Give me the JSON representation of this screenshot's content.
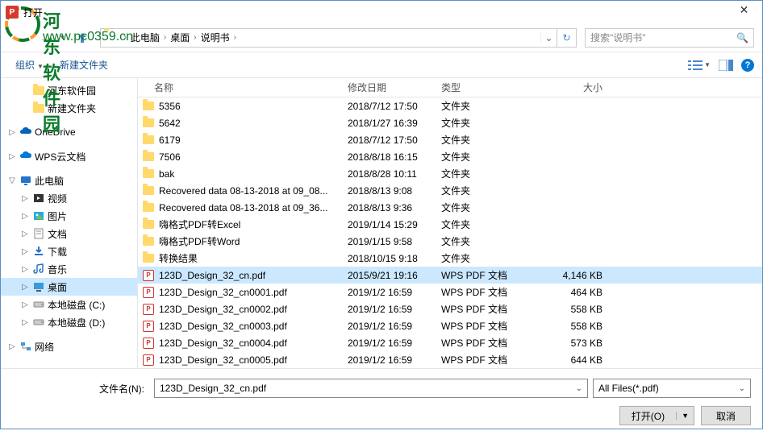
{
  "title": "打开",
  "watermark": {
    "text1": "河东软件园",
    "text2": "www.pc0359.cn"
  },
  "nav": {
    "crumbs": [
      "此电脑",
      "桌面",
      "说明书"
    ],
    "search_placeholder": "搜索\"说明书\""
  },
  "toolbar": {
    "organize": "组织",
    "new_folder": "新建文件夹"
  },
  "tree": [
    {
      "exp": "",
      "icon": "folder",
      "label": "河东软件园",
      "indent": 1
    },
    {
      "exp": "",
      "icon": "folder",
      "label": "新建文件夹",
      "indent": 1
    },
    {
      "spacer": true
    },
    {
      "exp": "▷",
      "icon": "onedrive",
      "label": "OneDrive",
      "indent": 0
    },
    {
      "spacer": true
    },
    {
      "exp": "▷",
      "icon": "wps",
      "label": "WPS云文档",
      "indent": 0
    },
    {
      "spacer": true
    },
    {
      "exp": "▽",
      "icon": "pc",
      "label": "此电脑",
      "indent": 0
    },
    {
      "exp": "▷",
      "icon": "video",
      "label": "视频",
      "indent": 1
    },
    {
      "exp": "▷",
      "icon": "pic",
      "label": "图片",
      "indent": 1
    },
    {
      "exp": "▷",
      "icon": "doc",
      "label": "文档",
      "indent": 1
    },
    {
      "exp": "▷",
      "icon": "dl",
      "label": "下载",
      "indent": 1
    },
    {
      "exp": "▷",
      "icon": "music",
      "label": "音乐",
      "indent": 1
    },
    {
      "exp": "▷",
      "icon": "desktop",
      "label": "桌面",
      "indent": 1,
      "sel": true
    },
    {
      "exp": "▷",
      "icon": "disk",
      "label": "本地磁盘 (C:)",
      "indent": 1
    },
    {
      "exp": "▷",
      "icon": "disk",
      "label": "本地磁盘 (D:)",
      "indent": 1
    },
    {
      "spacer": true
    },
    {
      "exp": "▷",
      "icon": "net",
      "label": "网络",
      "indent": 0
    }
  ],
  "columns": {
    "name": "名称",
    "date": "修改日期",
    "type": "类型",
    "size": "大小"
  },
  "rows": [
    {
      "icon": "folder",
      "name": "5356",
      "date": "2018/7/12 17:50",
      "type": "文件夹",
      "size": ""
    },
    {
      "icon": "folder",
      "name": "5642",
      "date": "2018/1/27 16:39",
      "type": "文件夹",
      "size": ""
    },
    {
      "icon": "folder",
      "name": "6179",
      "date": "2018/7/12 17:50",
      "type": "文件夹",
      "size": ""
    },
    {
      "icon": "folder",
      "name": "7506",
      "date": "2018/8/18 16:15",
      "type": "文件夹",
      "size": ""
    },
    {
      "icon": "folder",
      "name": "bak",
      "date": "2018/8/28 10:11",
      "type": "文件夹",
      "size": ""
    },
    {
      "icon": "folder",
      "name": "Recovered data 08-13-2018 at 09_08...",
      "date": "2018/8/13 9:08",
      "type": "文件夹",
      "size": ""
    },
    {
      "icon": "folder",
      "name": "Recovered data 08-13-2018 at 09_36...",
      "date": "2018/8/13 9:36",
      "type": "文件夹",
      "size": ""
    },
    {
      "icon": "folder",
      "name": "嗨格式PDF转Excel",
      "date": "2019/1/14 15:29",
      "type": "文件夹",
      "size": ""
    },
    {
      "icon": "folder",
      "name": "嗨格式PDF转Word",
      "date": "2019/1/15 9:58",
      "type": "文件夹",
      "size": ""
    },
    {
      "icon": "folder",
      "name": "转换结果",
      "date": "2018/10/15 9:18",
      "type": "文件夹",
      "size": ""
    },
    {
      "icon": "pdf",
      "name": "123D_Design_32_cn.pdf",
      "date": "2015/9/21 19:16",
      "type": "WPS PDF 文档",
      "size": "4,146 KB",
      "sel": true
    },
    {
      "icon": "pdf",
      "name": "123D_Design_32_cn0001.pdf",
      "date": "2019/1/2 16:59",
      "type": "WPS PDF 文档",
      "size": "464 KB"
    },
    {
      "icon": "pdf",
      "name": "123D_Design_32_cn0002.pdf",
      "date": "2019/1/2 16:59",
      "type": "WPS PDF 文档",
      "size": "558 KB"
    },
    {
      "icon": "pdf",
      "name": "123D_Design_32_cn0003.pdf",
      "date": "2019/1/2 16:59",
      "type": "WPS PDF 文档",
      "size": "558 KB"
    },
    {
      "icon": "pdf",
      "name": "123D_Design_32_cn0004.pdf",
      "date": "2019/1/2 16:59",
      "type": "WPS PDF 文档",
      "size": "573 KB"
    },
    {
      "icon": "pdf",
      "name": "123D_Design_32_cn0005.pdf",
      "date": "2019/1/2 16:59",
      "type": "WPS PDF 文档",
      "size": "644 KB"
    }
  ],
  "filename": {
    "label": "文件名(N):",
    "value": "123D_Design_32_cn.pdf"
  },
  "filetype": "All Files(*.pdf)",
  "buttons": {
    "open": "打开(O)",
    "cancel": "取消"
  }
}
